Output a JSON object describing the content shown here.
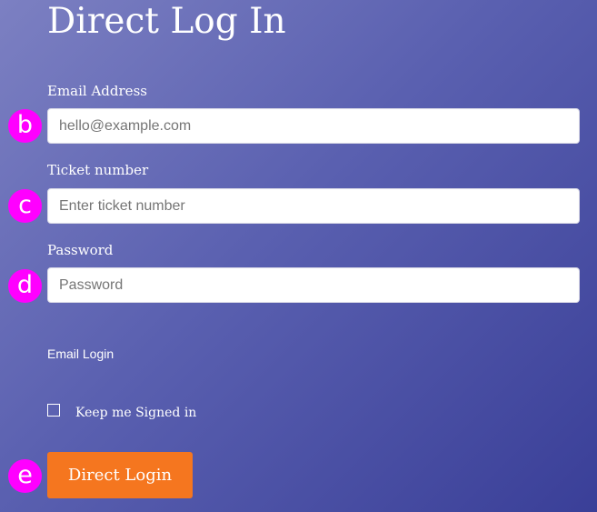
{
  "form": {
    "title": "Direct Log In",
    "email": {
      "label": "Email Address",
      "placeholder": "hello@example.com",
      "value": "",
      "marker": "b"
    },
    "ticket": {
      "label": "Ticket number",
      "placeholder": "Enter ticket number",
      "value": "",
      "marker": "c"
    },
    "password": {
      "label": "Password",
      "placeholder": "Password",
      "value": "",
      "marker": "d"
    },
    "email_login_link": "Email Login",
    "keep_signed_in": {
      "label": "Keep me Signed in",
      "checked": false
    },
    "submit": {
      "label": "Direct Login",
      "marker": "e"
    }
  },
  "colors": {
    "background_start": "#7c80c2",
    "background_end": "#3a3f98",
    "button": "#f5761f",
    "marker": "#ff00ff",
    "text": "#ffffff"
  }
}
